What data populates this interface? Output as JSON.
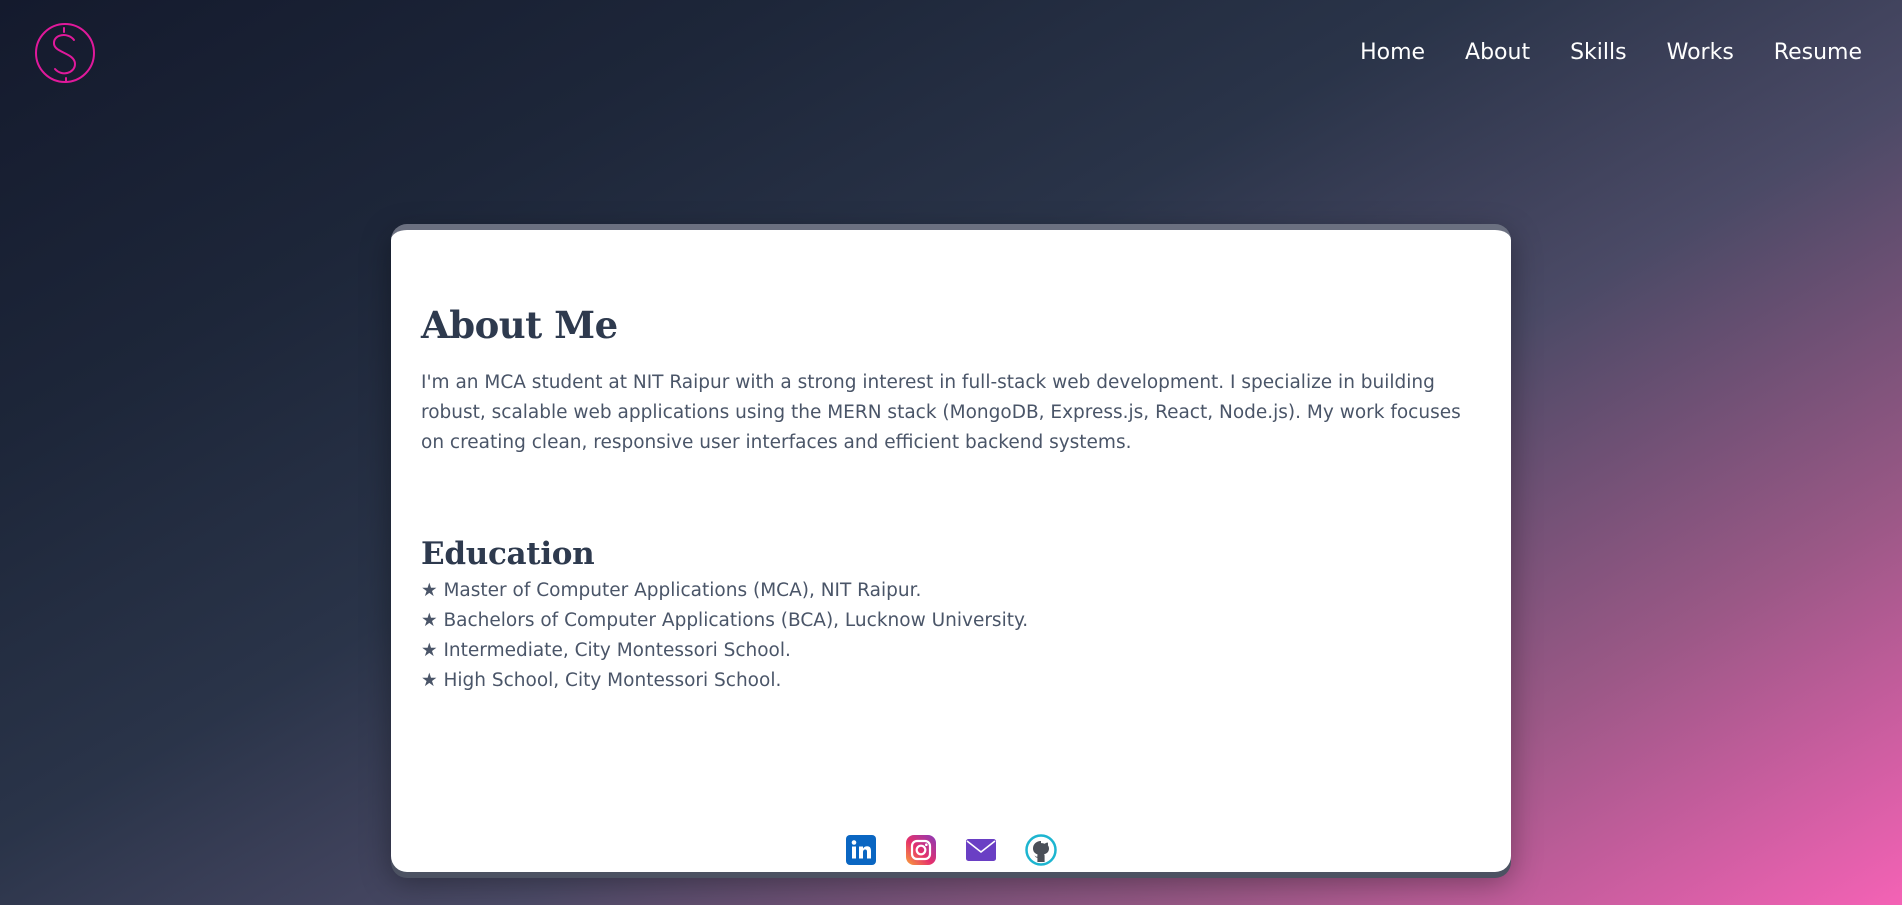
{
  "header": {
    "logo_icon": "s-monogram-logo-icon",
    "nav": [
      {
        "label": "Home"
      },
      {
        "label": "About"
      },
      {
        "label": "Skills"
      },
      {
        "label": "Works"
      },
      {
        "label": "Resume"
      }
    ]
  },
  "about": {
    "title": "About Me",
    "bio": "I'm an MCA student at NIT Raipur with a strong interest in full-stack web development. I specialize in building robust, scalable web applications using the MERN stack (MongoDB, Express.js, React, Node.js). My work focuses on creating clean, responsive user interfaces and efficient backend systems."
  },
  "education": {
    "title": "Education",
    "items": [
      "★ Master of Computer Applications (MCA), NIT Raipur.",
      "★ Bachelors of Computer Applications (BCA), Lucknow University.",
      "★ Intermediate, City Montessori School.",
      "★ High School, City Montessori School."
    ]
  },
  "socials": [
    {
      "icon": "linkedin-icon"
    },
    {
      "icon": "instagram-icon"
    },
    {
      "icon": "mail-icon"
    },
    {
      "icon": "github-icon"
    }
  ],
  "colors": {
    "logo": "#e0199b",
    "heading": "#2e3a4e",
    "body_text": "#4a5568",
    "linkedin": "#0a66c2",
    "mail": "#6a3fc4",
    "github_ring": "#1db5d0"
  }
}
